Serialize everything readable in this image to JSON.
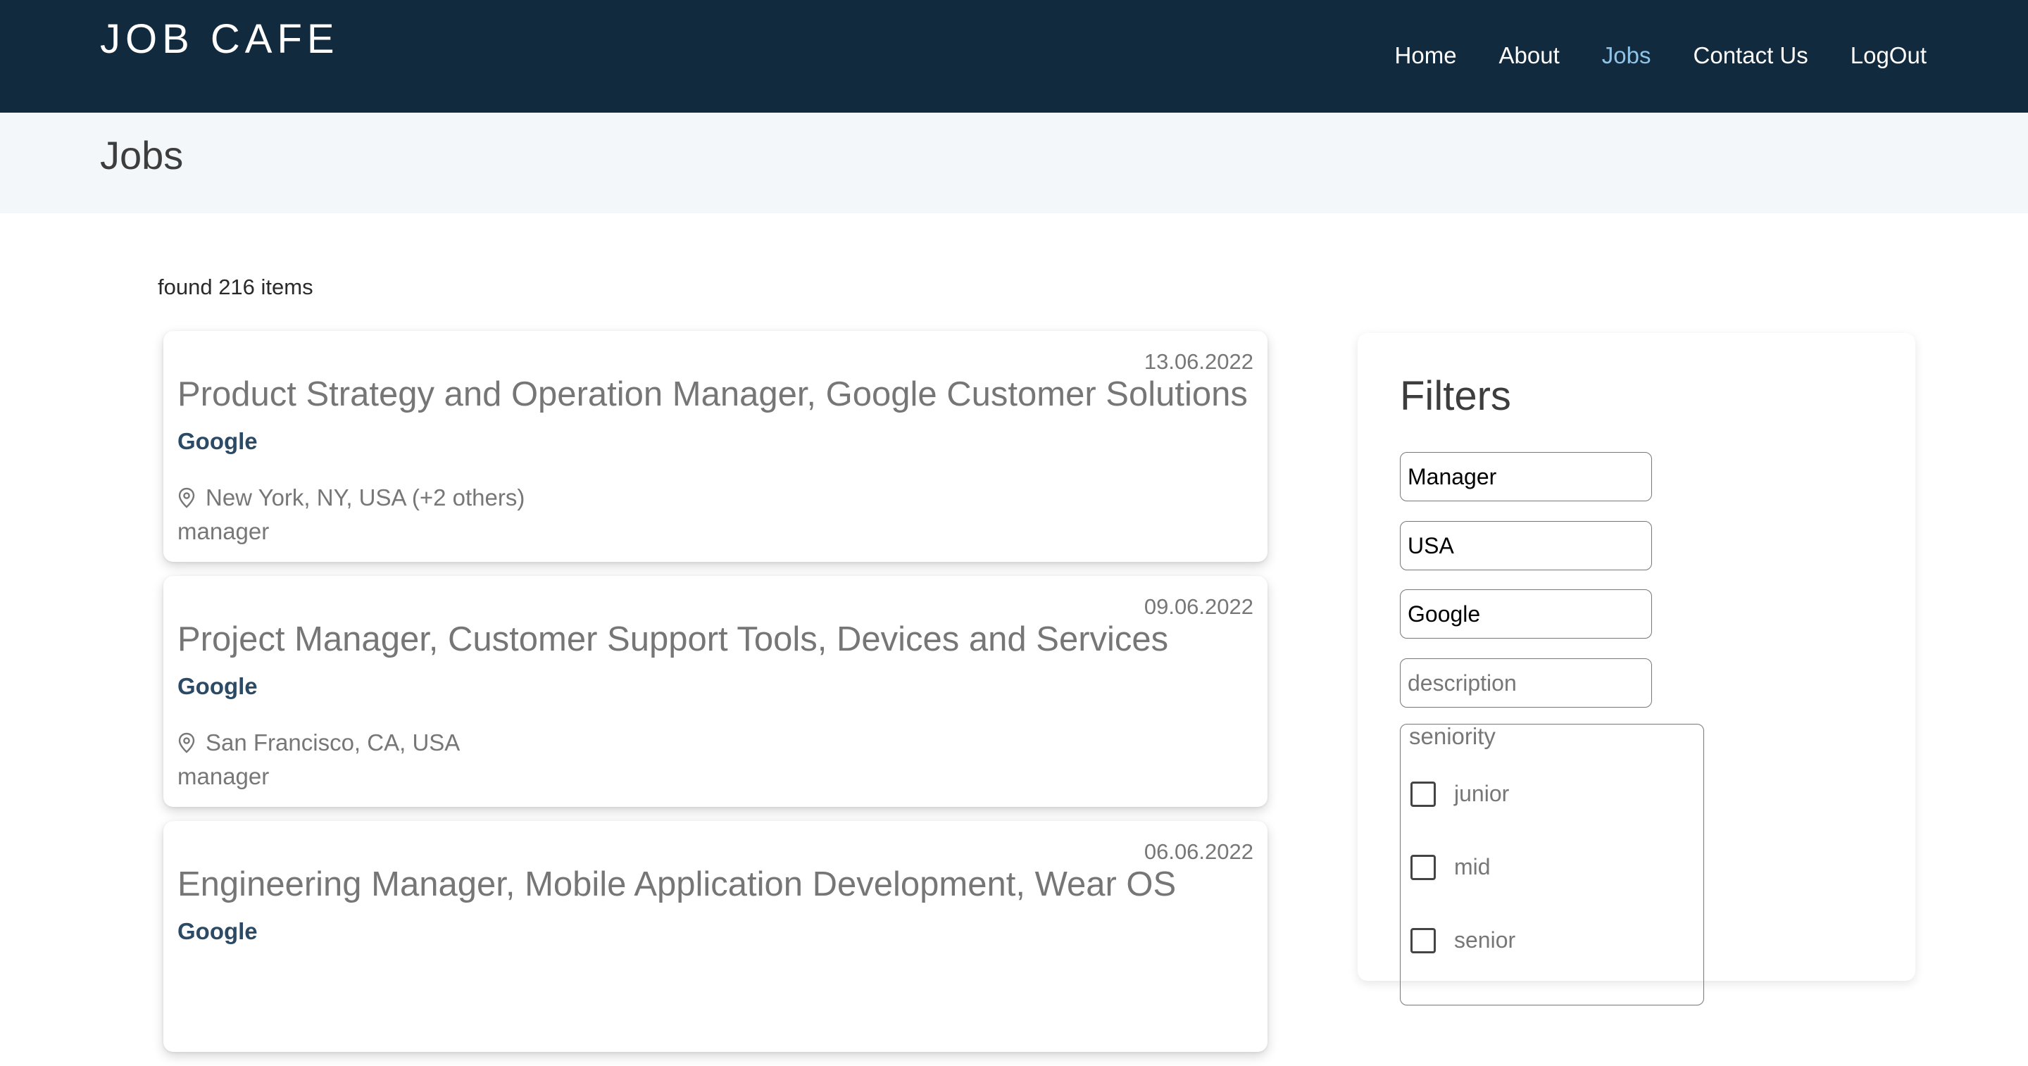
{
  "header": {
    "logo": "JOB CAFE",
    "nav": [
      "Home",
      "About",
      "Jobs",
      "Contact Us",
      "LogOut"
    ],
    "active": "Jobs"
  },
  "page": {
    "title": "Jobs"
  },
  "results": {
    "found_text": "found 216 items"
  },
  "jobs": [
    {
      "date": "13.06.2022",
      "title": "Product Strategy and Operation Manager, Google Customer Solutions",
      "company": "Google",
      "location": "New York, NY, USA (+2 others)",
      "seniority": "manager"
    },
    {
      "date": "09.06.2022",
      "title": "Project Manager, Customer Support Tools, Devices and Services",
      "company": "Google",
      "location": "San Francisco, CA, USA",
      "seniority": "manager"
    },
    {
      "date": "06.06.2022",
      "title": "Engineering Manager, Mobile Application Development, Wear OS",
      "company": "Google",
      "location": "",
      "seniority": ""
    }
  ],
  "filters": {
    "title": "Filters",
    "position_value": "Manager",
    "country_value": "USA",
    "company_value": "Google",
    "description_placeholder": "description",
    "seniority_legend": "seniority",
    "seniority_options": [
      "junior",
      "mid",
      "senior"
    ]
  },
  "colors": {
    "header_bg": "#122a3e",
    "active_nav": "#8fc3e8",
    "company": "#2b4a66"
  }
}
